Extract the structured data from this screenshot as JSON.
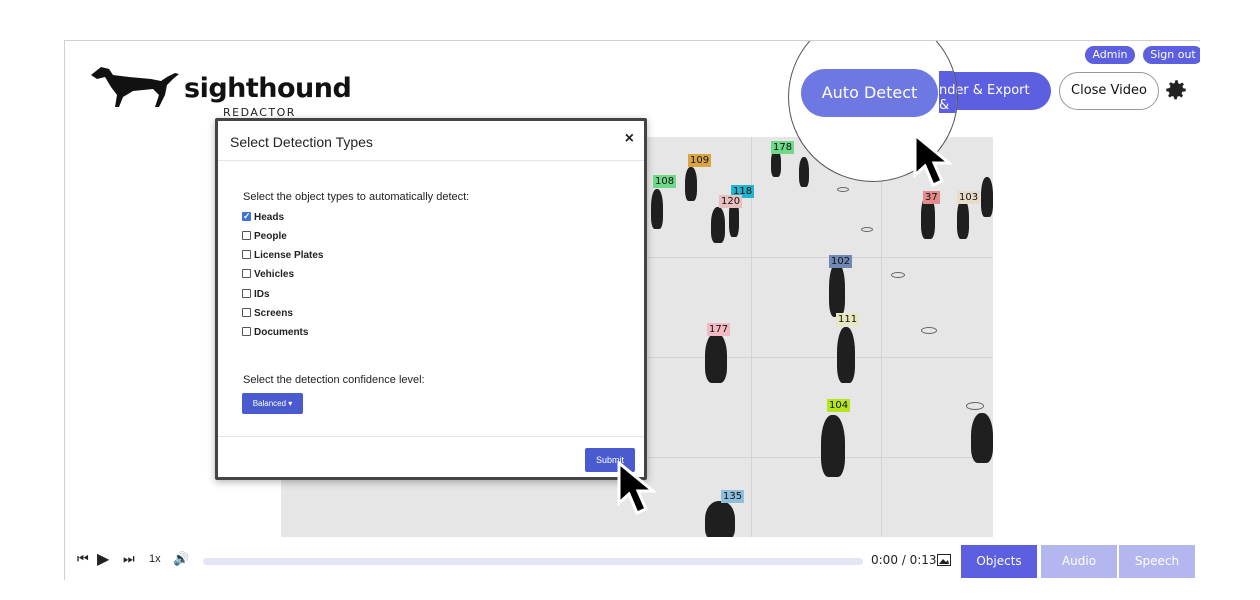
{
  "header": {
    "logo_text": "sighthound",
    "logo_sub": "REDACTOR",
    "admin_label": "Admin",
    "signout_label": "Sign out",
    "render_label": "Render & Export",
    "close_label": "Close Video",
    "auto_detect_label": "Auto Detect",
    "render_partial_label": "nder & Export"
  },
  "video": {
    "tags": [
      {
        "label": "178",
        "color": "#6fd98a"
      },
      {
        "label": "109",
        "color": "#d9a441"
      },
      {
        "label": "108",
        "color": "#6fd98a"
      },
      {
        "label": "118",
        "color": "#24b4cf"
      },
      {
        "label": "120",
        "color": "#e8c0c0"
      },
      {
        "label": "37",
        "color": "#e38b8b"
      },
      {
        "label": "103",
        "color": "#e8dcc8"
      },
      {
        "label": "102",
        "color": "#6f88b4"
      },
      {
        "label": "111",
        "color": "#e8e8c0"
      },
      {
        "label": "177",
        "color": "#f0b9c3"
      },
      {
        "label": "104",
        "color": "#b5e61d"
      },
      {
        "label": "135",
        "color": "#8fbfdc"
      }
    ]
  },
  "modal": {
    "title": "Select Detection Types",
    "close": "×",
    "description": "Select the object types to automatically detect:",
    "options": [
      {
        "label": "Heads",
        "checked": true
      },
      {
        "label": "People",
        "checked": false
      },
      {
        "label": "License Plates",
        "checked": false
      },
      {
        "label": "Vehicles",
        "checked": false
      },
      {
        "label": "IDs",
        "checked": false
      },
      {
        "label": "Screens",
        "checked": false
      },
      {
        "label": "Documents",
        "checked": false
      }
    ],
    "confidence_label": "Select the detection confidence level:",
    "confidence_value": "Balanced",
    "submit_label": "Submit"
  },
  "controls": {
    "speed": "1x",
    "time": "0:00 / 0:13",
    "tabs": [
      {
        "label": "Objects",
        "color": "#5b5fe0"
      },
      {
        "label": "Audio",
        "color": "#b4b6ef"
      },
      {
        "label": "Speech",
        "color": "#b4b6ef"
      }
    ]
  },
  "colors": {
    "accent": "#5b5fe0",
    "accent_light": "#b4b6ef"
  }
}
